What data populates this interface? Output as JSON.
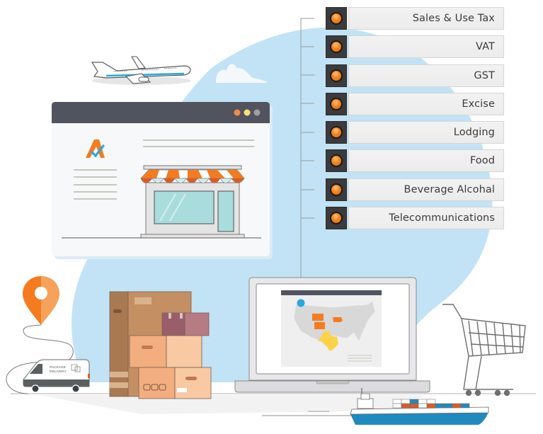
{
  "tax_types": [
    {
      "label": "Sales & Use Tax"
    },
    {
      "label": "VAT"
    },
    {
      "label": "GST"
    },
    {
      "label": "Excise"
    },
    {
      "label": "Lodging"
    },
    {
      "label": "Food"
    },
    {
      "label": "Beverage Alcohal"
    },
    {
      "label": "Telecommunications"
    }
  ],
  "van": {
    "line1": "PACKAGE",
    "line2": "DELIVERY"
  },
  "colors": {
    "accent_orange": "#f7851e",
    "background_blue": "#c1e3f5",
    "window_titlebar": "#51535f",
    "highlight_state_orange": "#f47b20",
    "highlight_state_yellow": "#fcd247",
    "map_pin_blue": "#29a8e0"
  },
  "browser_window": {
    "controls": [
      "close-dot",
      "minimize-dot",
      "maximize-dot"
    ]
  },
  "map": {
    "highlighted_states": [
      "Wyoming",
      "Colorado",
      "Iowa",
      "Texas"
    ]
  }
}
